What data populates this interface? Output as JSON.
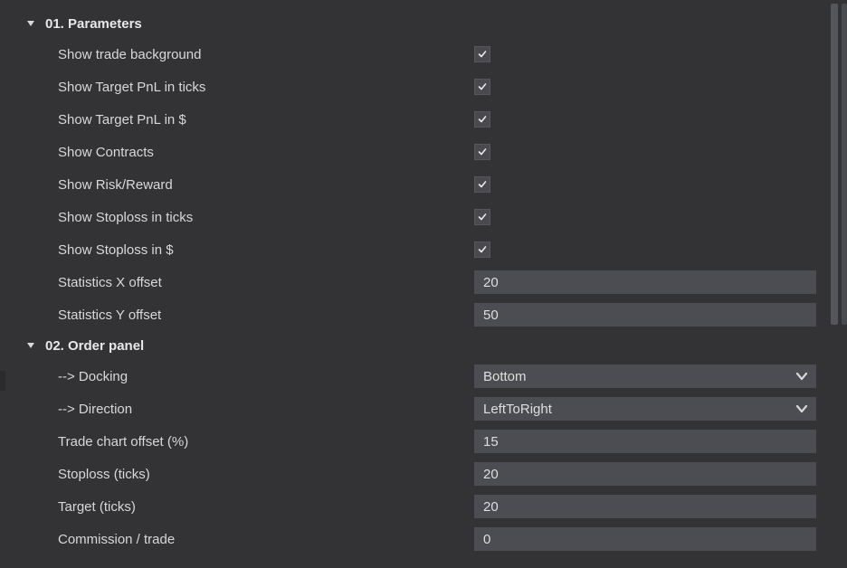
{
  "sections": [
    {
      "title": "01. Parameters",
      "rows": [
        {
          "kind": "check",
          "label": "Show trade background",
          "checked": true,
          "name": "show-trade-background"
        },
        {
          "kind": "check",
          "label": "Show Target PnL in ticks",
          "checked": true,
          "name": "show-target-pnl-ticks"
        },
        {
          "kind": "check",
          "label": "Show Target PnL in $",
          "checked": true,
          "name": "show-target-pnl-usd"
        },
        {
          "kind": "check",
          "label": "Show Contracts",
          "checked": true,
          "name": "show-contracts"
        },
        {
          "kind": "check",
          "label": "Show Risk/Reward",
          "checked": true,
          "name": "show-risk-reward"
        },
        {
          "kind": "check",
          "label": "Show Stoploss in ticks",
          "checked": true,
          "name": "show-stoploss-ticks"
        },
        {
          "kind": "check",
          "label": "Show Stoploss in $",
          "checked": true,
          "name": "show-stoploss-usd"
        },
        {
          "kind": "text",
          "label": "Statistics X offset",
          "value": "20",
          "name": "statistics-x-offset"
        },
        {
          "kind": "text",
          "label": "Statistics Y offset",
          "value": "50",
          "name": "statistics-y-offset"
        }
      ]
    },
    {
      "title": "02. Order panel",
      "rows": [
        {
          "kind": "select",
          "label": "--> Docking",
          "value": "Bottom",
          "name": "docking"
        },
        {
          "kind": "select",
          "label": "--> Direction",
          "value": "LeftToRight",
          "name": "direction"
        },
        {
          "kind": "text",
          "label": "Trade chart offset (%)",
          "value": "15",
          "name": "trade-chart-offset"
        },
        {
          "kind": "text",
          "label": "Stoploss (ticks)",
          "value": "20",
          "name": "stoploss-ticks"
        },
        {
          "kind": "text",
          "label": "Target (ticks)",
          "value": "20",
          "name": "target-ticks"
        },
        {
          "kind": "text",
          "label": "Commission / trade",
          "value": "0",
          "name": "commission-per-trade"
        }
      ]
    }
  ]
}
